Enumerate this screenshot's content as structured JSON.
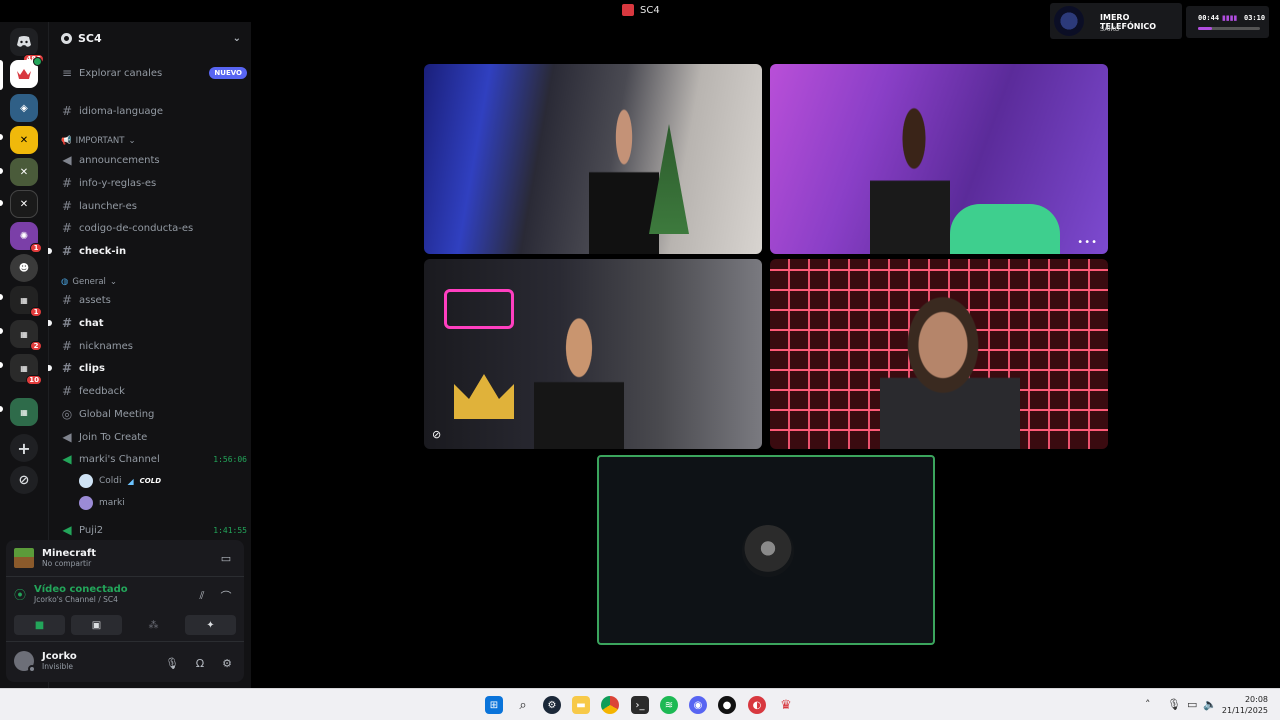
{
  "window": {
    "title": "SC4"
  },
  "rail": {
    "notif_badge": "486",
    "badges": [
      "1",
      "1",
      "2",
      "10"
    ]
  },
  "server": {
    "name": "SC4",
    "explore_label": "Explorar canales",
    "new_badge": "NUEVO"
  },
  "channels": {
    "idioma": "idioma-language",
    "important_category": "IMPORTANT",
    "announcements": "announcements",
    "info": "info-y-reglas-es",
    "launcher": "launcher-es",
    "codigo": "codigo-de-conducta-es",
    "checkin": "check-in",
    "general_category": "General",
    "assets": "assets",
    "chat": "chat",
    "nicknames": "nicknames",
    "clips": "clips",
    "feedback": "feedback",
    "global_meeting": "Global Meeting",
    "join_to_create": "Join To Create",
    "markis_channel": "marki's Channel",
    "markis_timer": "1:56:06",
    "voice_user_1": "Coldi",
    "voice_user_1_tag": "COLD",
    "voice_user_2": "marki",
    "puji": "Puji2",
    "puji_timer": "1:41:55"
  },
  "activity": {
    "game": "Minecraft",
    "status": "No compartir"
  },
  "voice": {
    "status": "Vídeo conectado",
    "location": "Jcorko's Channel / SC4"
  },
  "user": {
    "name": "Jcorko",
    "status": "Invisible"
  },
  "overlay": {
    "name": "IMERO TELEFÓNICO",
    "sub": "SAIKO",
    "time_elapsed": "00:44",
    "time_total": "03:10",
    "progress": 0.23
  },
  "taskbar": {
    "time": "20:08",
    "date": "21/11/2025"
  },
  "colors": {
    "accent": "#5865f2",
    "voice_green": "#23a55a",
    "focus_border": "#3ba55d"
  }
}
